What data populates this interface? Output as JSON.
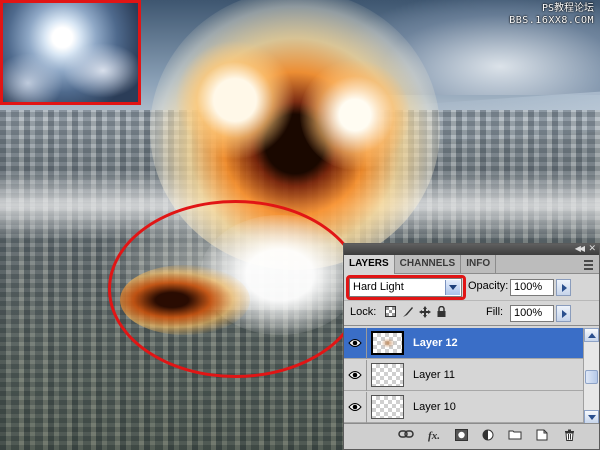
{
  "watermark": {
    "line1": "PS教程论坛",
    "line2": "BBS.16XX8.COM"
  },
  "colors": {
    "highlight": "#e11515",
    "selected_row": "#3a6ec7",
    "panel_bg": "#d6d6d6"
  },
  "panel": {
    "tabs": [
      {
        "label": "LAYERS",
        "active": true
      },
      {
        "label": "CHANNELS",
        "active": false
      },
      {
        "label": "INFO",
        "active": false
      }
    ],
    "blend_mode": "Hard Light",
    "opacity_label": "Opacity:",
    "opacity_value": "100%",
    "lock_label": "Lock:",
    "fill_label": "Fill:",
    "fill_value": "100%",
    "lock_icons": [
      "lock-transparent-icon",
      "lock-image-icon",
      "lock-position-icon",
      "lock-all-icon"
    ],
    "layers": [
      {
        "name": "Layer 12",
        "selected": true,
        "visible": true
      },
      {
        "name": "Layer 11",
        "selected": false,
        "visible": true
      },
      {
        "name": "Layer 10",
        "selected": false,
        "visible": true
      }
    ],
    "bottom_icons": [
      "link-layers-icon",
      "fx-icon",
      "add-mask-icon",
      "adjustment-layer-icon",
      "new-group-icon",
      "new-layer-icon",
      "trash-icon"
    ],
    "fx_label": "fx."
  }
}
